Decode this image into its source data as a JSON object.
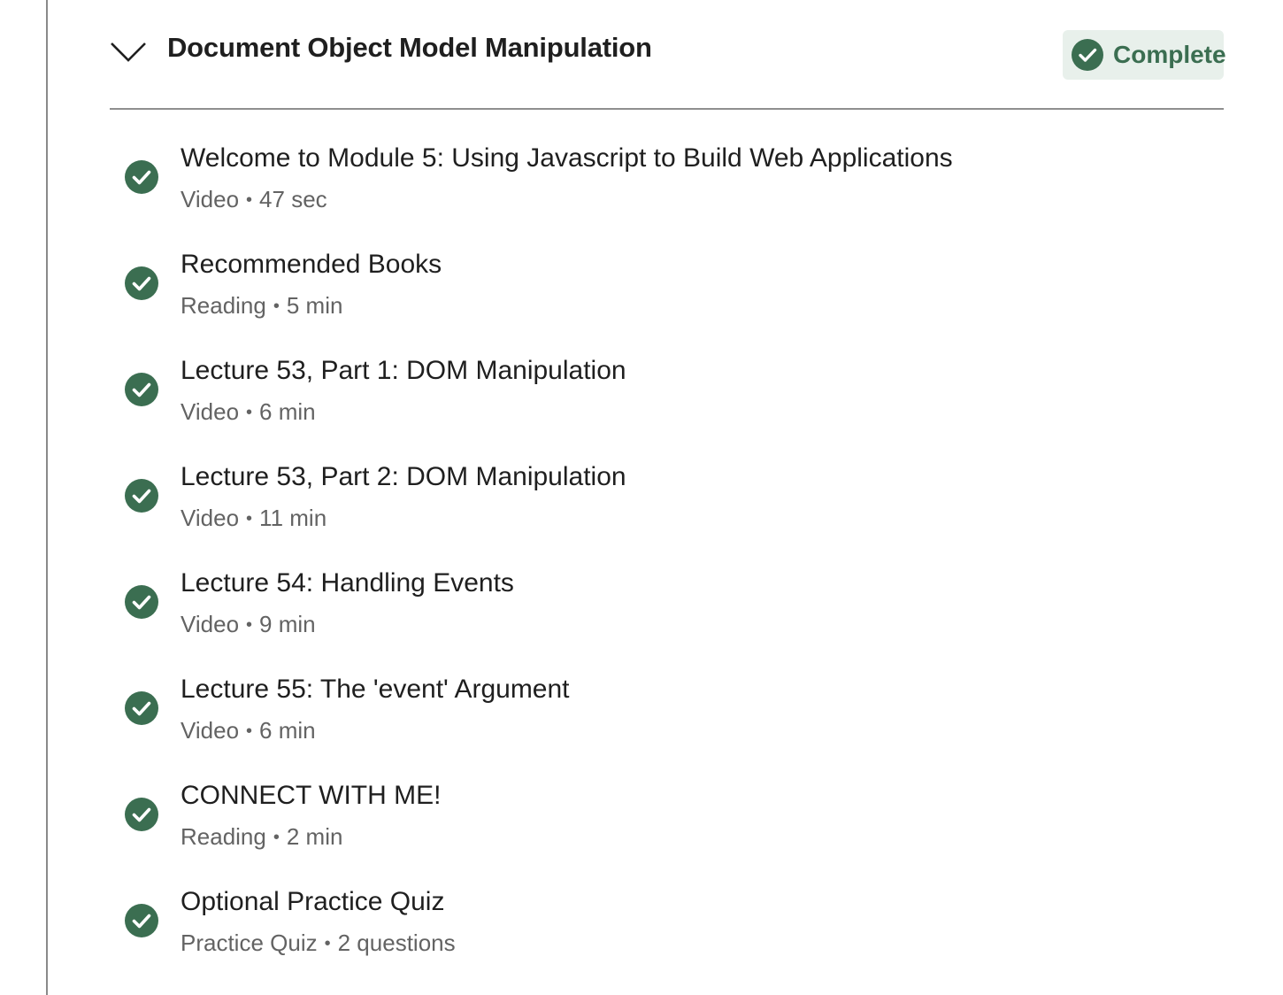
{
  "colors": {
    "check_green": "#3b6e51",
    "badge_bg": "#e8f0eb",
    "title_text": "#1f1f1f",
    "meta_text": "#636363",
    "divider": "#8f8f8f"
  },
  "module": {
    "title": "Document Object Model Manipulation",
    "toggle_icon": "chevron-down-icon",
    "status": {
      "label": "Complete",
      "icon": "check-circle-icon"
    }
  },
  "items": [
    {
      "title": "Welcome to Module 5: Using Javascript to Build Web Applications",
      "type": "Video",
      "separator": "•",
      "duration": "47 sec",
      "completed": true
    },
    {
      "title": "Recommended Books",
      "type": "Reading",
      "separator": "•",
      "duration": "5 min",
      "completed": true
    },
    {
      "title": "Lecture 53, Part 1: DOM Manipulation",
      "type": "Video",
      "separator": "•",
      "duration": "6 min",
      "completed": true
    },
    {
      "title": "Lecture 53, Part 2: DOM Manipulation",
      "type": "Video",
      "separator": "•",
      "duration": "11 min",
      "completed": true
    },
    {
      "title": "Lecture 54: Handling Events",
      "type": "Video",
      "separator": "•",
      "duration": "9 min",
      "completed": true
    },
    {
      "title": "Lecture 55: The 'event' Argument",
      "type": "Video",
      "separator": "•",
      "duration": "6 min",
      "completed": true
    },
    {
      "title": "CONNECT WITH ME!",
      "type": "Reading",
      "separator": "•",
      "duration": "2 min",
      "completed": true
    },
    {
      "title": "Optional Practice Quiz",
      "type": "Practice Quiz",
      "separator": "•",
      "duration": "2 questions",
      "completed": true
    }
  ]
}
